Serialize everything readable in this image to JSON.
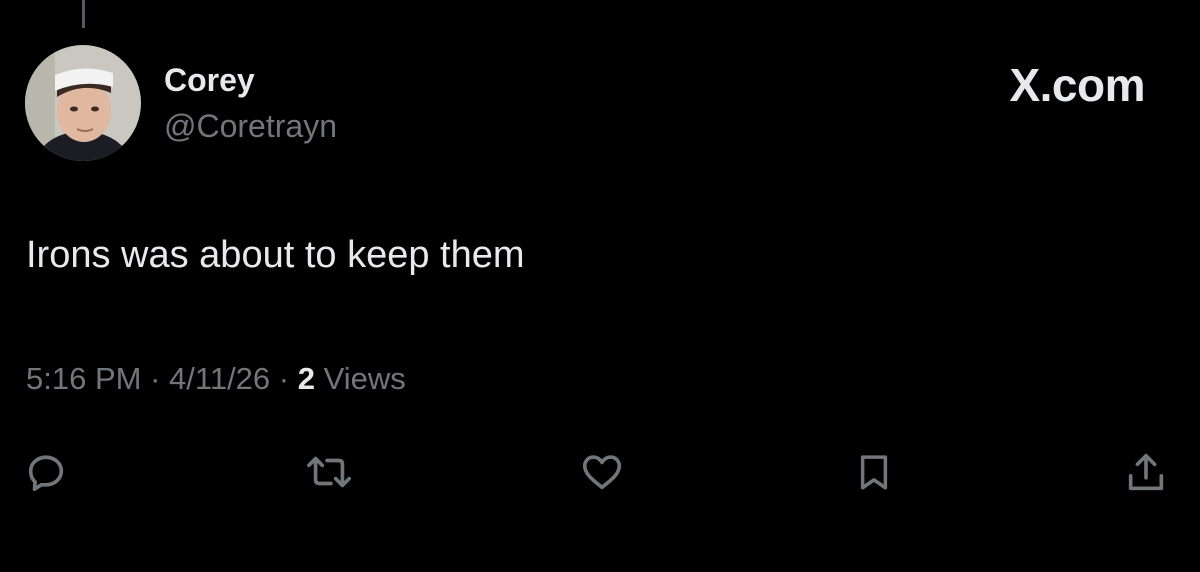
{
  "author": {
    "name": "Corey",
    "handle": "@Coretrayn"
  },
  "brand": {
    "label": "X.com"
  },
  "tweet": {
    "text": "Irons was about to keep them",
    "time": "5:16 PM",
    "date": "4/11/26",
    "separator": "·",
    "views_count": "2",
    "views_label": "Views"
  },
  "actions": [
    {
      "icon": "reply-icon"
    },
    {
      "icon": "retweet-icon"
    },
    {
      "icon": "like-icon"
    },
    {
      "icon": "bookmark-icon"
    },
    {
      "icon": "share-icon"
    }
  ],
  "colors": {
    "background": "#000000",
    "primary_text": "#e7e9ea",
    "secondary_text": "#71767b",
    "icon": "#71767b"
  }
}
